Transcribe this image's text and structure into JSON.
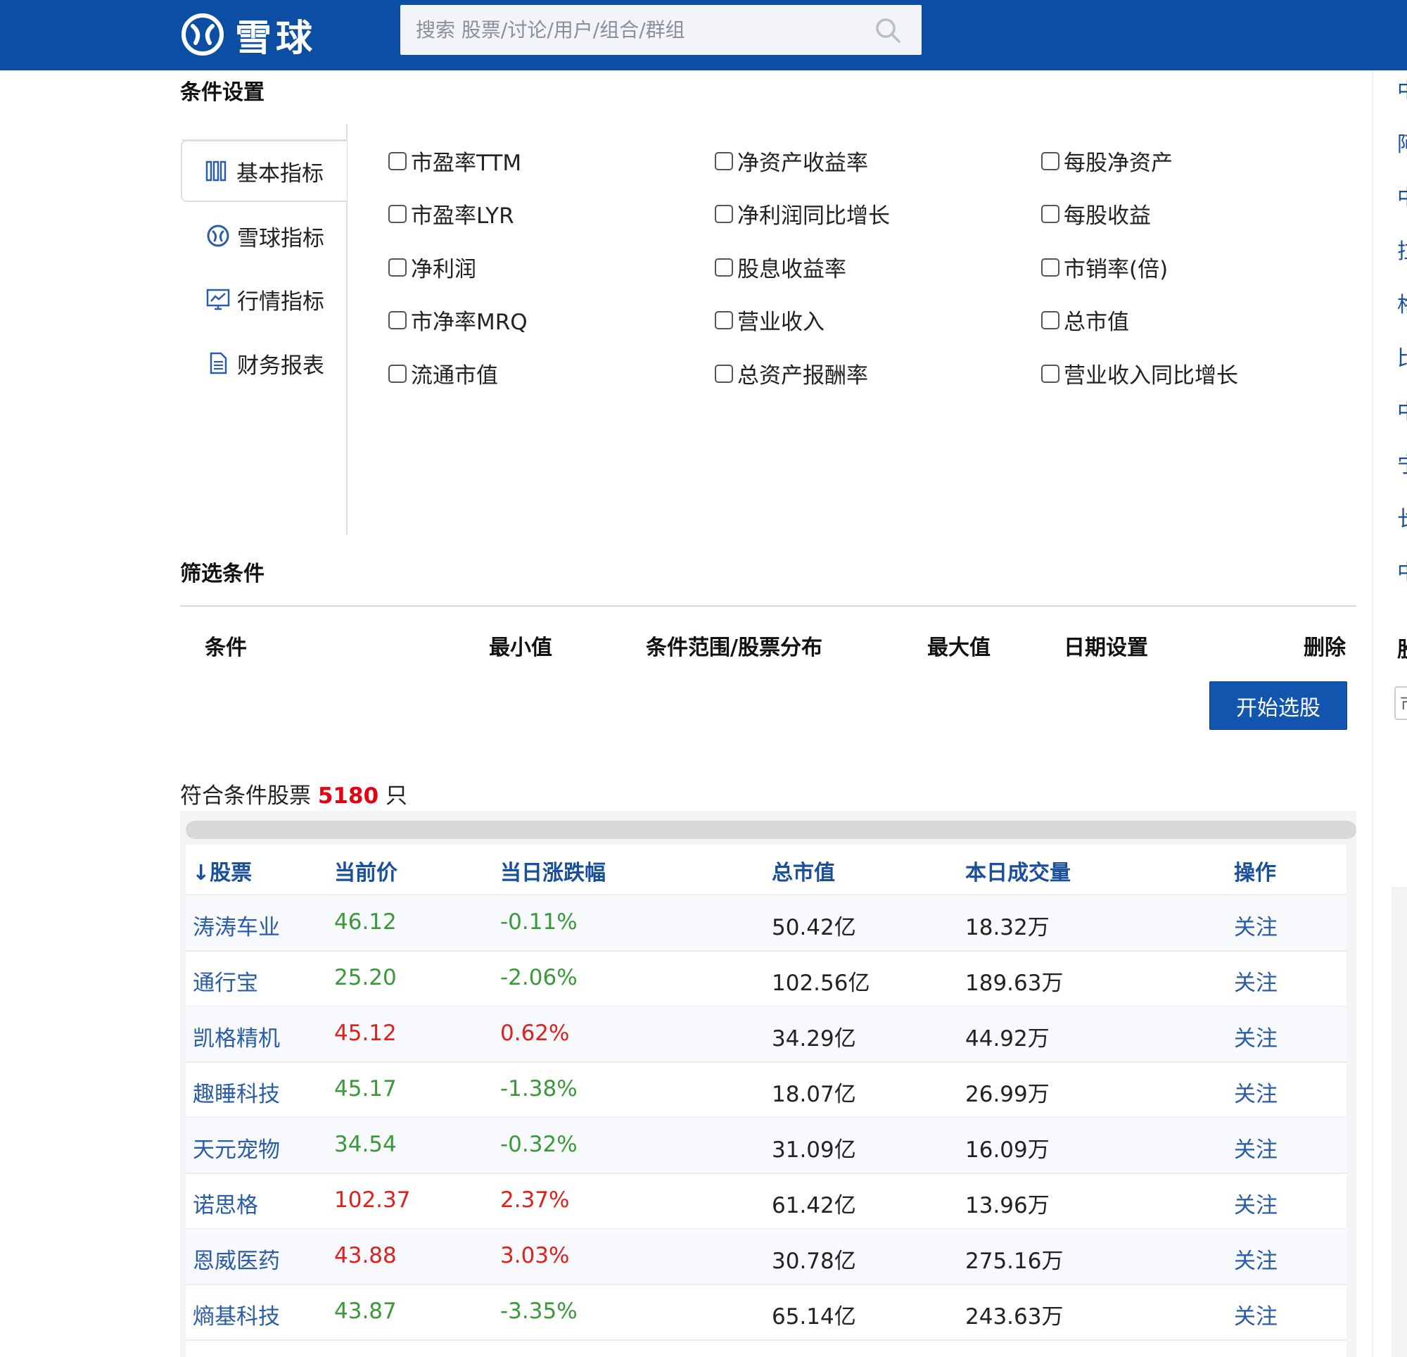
{
  "header": {
    "logo_text": "雪球",
    "search_placeholder": "搜索 股票/讨论/用户/组合/群组"
  },
  "condition_settings": {
    "title": "条件设置",
    "tabs": [
      {
        "label": "基本指标",
        "icon": "bar-grid-icon",
        "active": true
      },
      {
        "label": "雪球指标",
        "icon": "snowball-icon",
        "active": false
      },
      {
        "label": "行情指标",
        "icon": "market-chart-icon",
        "active": false
      },
      {
        "label": "财务报表",
        "icon": "document-icon",
        "active": false
      }
    ],
    "indicators": [
      "市盈率TTM",
      "净资产收益率",
      "每股净资产",
      "市盈率LYR",
      "净利润同比增长",
      "每股收益",
      "净利润",
      "股息收益率",
      "市销率(倍)",
      "市净率MRQ",
      "营业收入",
      "总市值",
      "流通市值",
      "总资产报酬率",
      "营业收入同比增长"
    ]
  },
  "filter": {
    "title": "筛选条件",
    "columns": [
      "条件",
      "最小值",
      "条件范围/股票分布",
      "最大值",
      "日期设置",
      "删除"
    ],
    "start_button": "开始选股"
  },
  "results": {
    "prefix": "符合条件股票",
    "count": "5180",
    "suffix": "只",
    "columns": [
      "股票",
      "当前价",
      "当日涨跌幅",
      "总市值",
      "本日成交量",
      "操作"
    ],
    "sort_arrow": "↓",
    "rows": [
      {
        "name": "涛涛车业",
        "price": "46.12",
        "change": "-0.11%",
        "cap": "50.42亿",
        "volume": "18.32万",
        "action": "关注",
        "dir": "down"
      },
      {
        "name": "通行宝",
        "price": "25.20",
        "change": "-2.06%",
        "cap": "102.56亿",
        "volume": "189.63万",
        "action": "关注",
        "dir": "down"
      },
      {
        "name": "凯格精机",
        "price": "45.12",
        "change": "0.62%",
        "cap": "34.29亿",
        "volume": "44.92万",
        "action": "关注",
        "dir": "up"
      },
      {
        "name": "趣睡科技",
        "price": "45.17",
        "change": "-1.38%",
        "cap": "18.07亿",
        "volume": "26.99万",
        "action": "关注",
        "dir": "down"
      },
      {
        "name": "天元宠物",
        "price": "34.54",
        "change": "-0.32%",
        "cap": "31.09亿",
        "volume": "16.09万",
        "action": "关注",
        "dir": "down"
      },
      {
        "name": "诺思格",
        "price": "102.37",
        "change": "2.37%",
        "cap": "61.42亿",
        "volume": "13.96万",
        "action": "关注",
        "dir": "up"
      },
      {
        "name": "恩威医药",
        "price": "43.88",
        "change": "3.03%",
        "cap": "30.78亿",
        "volume": "275.16万",
        "action": "关注",
        "dir": "up"
      },
      {
        "name": "熵基科技",
        "price": "43.87",
        "change": "-3.35%",
        "cap": "65.14亿",
        "volume": "243.63万",
        "action": "关注",
        "dir": "down"
      }
    ]
  },
  "right_sidebar": {
    "stubs": [
      "中",
      "阿",
      "中",
      "拉",
      "格",
      "比",
      "中",
      "宁",
      "长",
      "中",
      "股",
      "市"
    ]
  },
  "colors": {
    "brand": "#0B4EA3",
    "button": "#1155AF",
    "link": "#2a5ca8",
    "up": "#e0201e",
    "down": "#3a9a3a",
    "count": "#e60012"
  }
}
